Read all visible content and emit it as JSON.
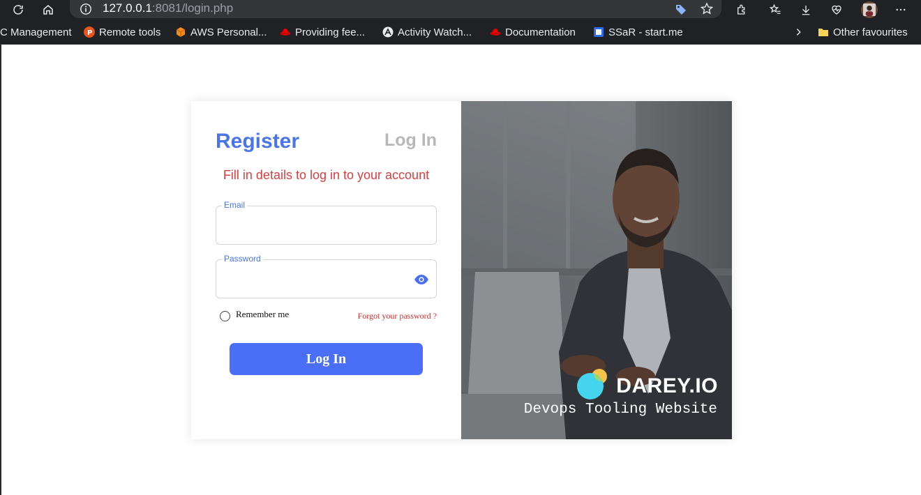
{
  "browser": {
    "url_host": "127.0.0.1",
    "url_rest": ":8081/login.php",
    "bookmarks": [
      {
        "label": "C Management",
        "icon": "none"
      },
      {
        "label": "Remote tools",
        "icon": "p-circle-icon"
      },
      {
        "label": "AWS Personal...",
        "icon": "aws-cube-icon"
      },
      {
        "label": "Providing fee...",
        "icon": "redhat-icon"
      },
      {
        "label": "Activity Watch...",
        "icon": "activitywatch-icon"
      },
      {
        "label": "Documentation",
        "icon": "redhat-icon"
      },
      {
        "label": "SSaR - start.me",
        "icon": "startme-icon"
      }
    ],
    "other_favourites": "Other favourites"
  },
  "login": {
    "tab_register": "Register",
    "tab_login": "Log In",
    "subtitle": "Fill in details to log in to your account",
    "email_label": "Email",
    "email_value": "",
    "password_label": "Password",
    "password_value": "",
    "remember_label": "Remember me",
    "forgot_label": "Forgot your password ?",
    "button_label": "Log In"
  },
  "hero": {
    "brand_name": "DAREY.IO",
    "tagline": "Devops Tooling Website"
  },
  "colors": {
    "accent_blue": "#4a74ea",
    "button_blue": "#4a6ef5",
    "error_red": "#e03c3c",
    "inactive_tab": "#b8b8b8",
    "chrome_bg": "#202124"
  }
}
